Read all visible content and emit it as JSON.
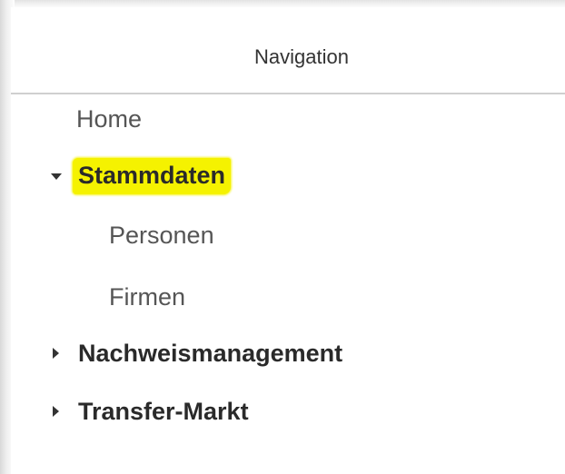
{
  "panel": {
    "title": "Navigation"
  },
  "nav": {
    "home": {
      "label": "Home"
    },
    "stammdaten": {
      "label": "Stammdaten",
      "expanded": true,
      "highlighted": true,
      "children": [
        {
          "label": "Personen"
        },
        {
          "label": "Firmen"
        }
      ]
    },
    "nachweismanagement": {
      "label": "Nachweismanagement",
      "expanded": false
    },
    "transfer_markt": {
      "label": "Transfer-Markt",
      "expanded": false
    }
  },
  "colors": {
    "highlight": "#f5f200",
    "text_primary": "#2a2a2a",
    "text_secondary": "#555555",
    "divider": "#cfcfcf"
  },
  "icons": {
    "expanded": "caret-down-icon",
    "collapsed": "caret-right-icon"
  }
}
